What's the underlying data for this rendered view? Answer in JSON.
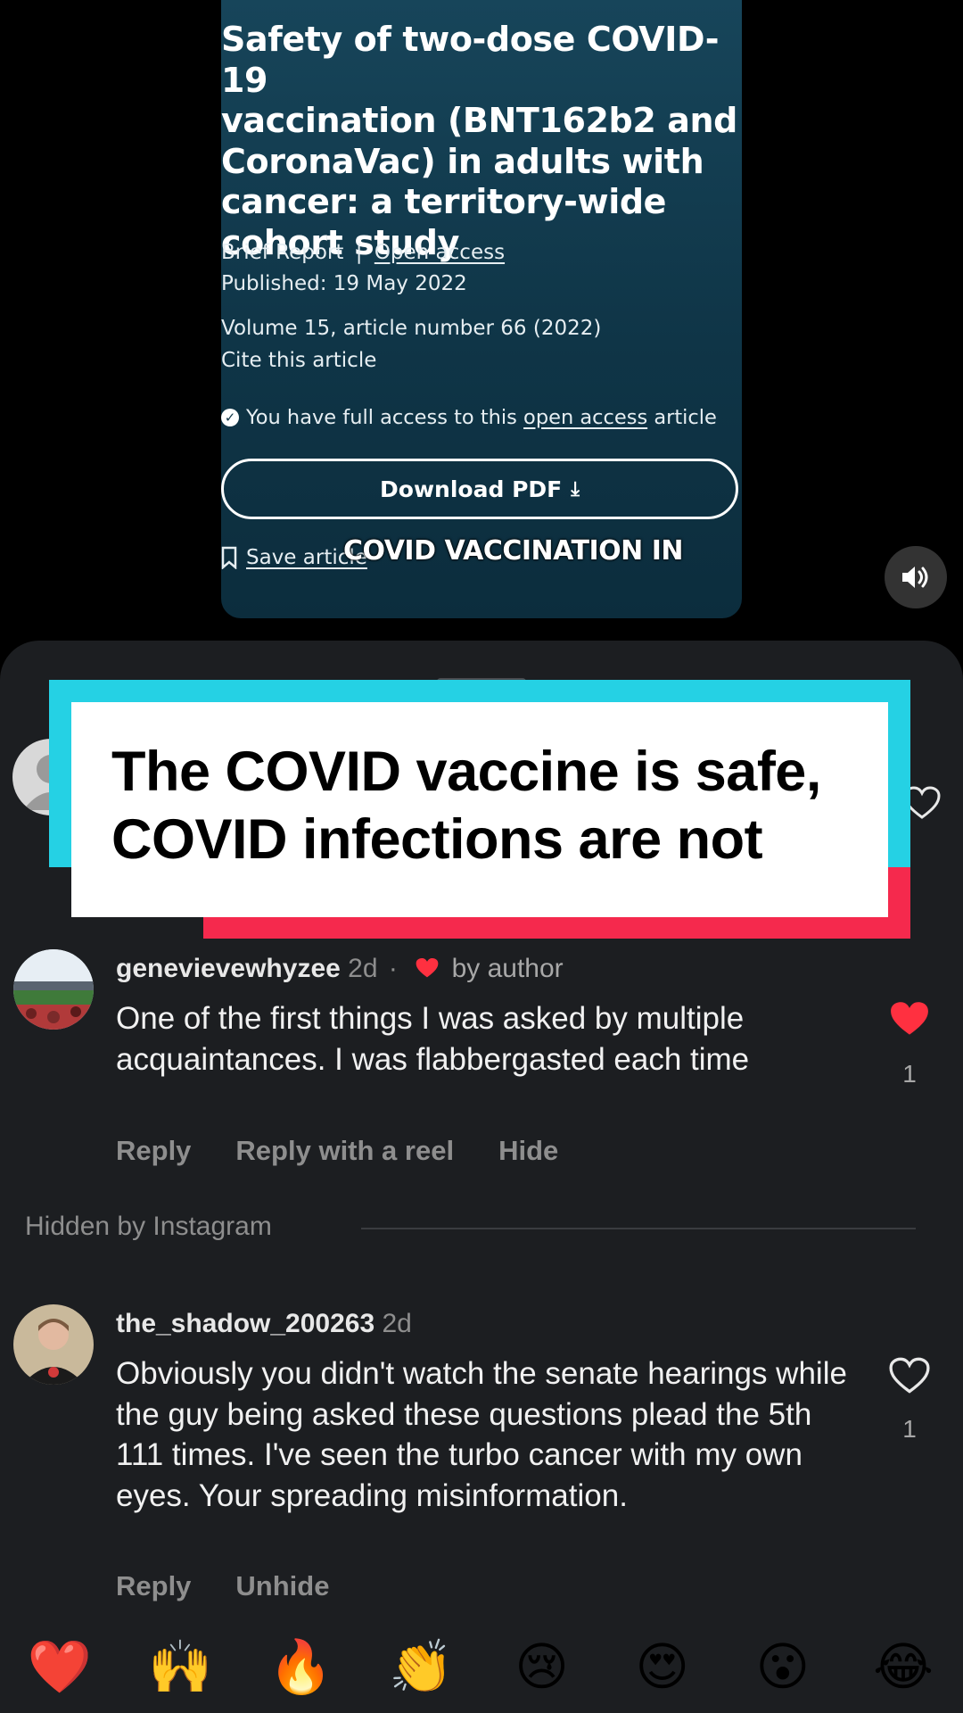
{
  "article": {
    "title": "Safety of two-dose COVID-19\nvaccination (BNT162b2 and\nCoronaVac) in adults with\ncancer: a territory-wide\ncohort study",
    "type": "Brief Report",
    "separator": "|",
    "access_link": "Open access",
    "published": "Published: 19 May 2022",
    "volume": "Volume 15, article number 66 (2022)",
    "cite": "Cite this article",
    "access_prefix": "You have full access to this ",
    "access_mid": "open access",
    "access_suffix": " article",
    "download_label": "Download PDF",
    "download_icon": "⤓",
    "save_label": "Save article"
  },
  "video": {
    "caption": "COVID VACCINATION IN",
    "sound_icon": "speaker-icon"
  },
  "banner": {
    "text": "The COVID vaccine is safe, COVID infections are not",
    "colors": {
      "cyan": "#25d1e4",
      "red": "#f5294d",
      "white": "#ffffff"
    }
  },
  "comments": [
    {
      "username": "genevievewhyzee",
      "time": "2d",
      "sep": "·",
      "liked_by_author": "by author",
      "body": "One of the first things I was asked by multiple acquaintances. I was flabbergasted each time",
      "actions": [
        "Reply",
        "Reply with a reel",
        "Hide"
      ],
      "likes": "1",
      "liked": true
    },
    {
      "username": "the_shadow_200263",
      "time": "2d",
      "body": "Obviously you didn't watch the senate hearings while the guy being asked these questions plead the 5th 111 times. I've seen the turbo cancer with my own eyes.  Your spreading misinformation.",
      "actions": [
        "Reply",
        "Unhide"
      ],
      "likes": "1",
      "liked": false
    }
  ],
  "hidden_label": "Hidden by Instagram",
  "emoji_bar": [
    "❤️",
    "🙌",
    "🔥",
    "👏",
    "😢",
    "😍",
    "😮",
    "😂"
  ],
  "theme": {
    "sheet_bg": "#1c1e21",
    "like_red": "#ff3040",
    "muted": "#8e8e8e"
  }
}
